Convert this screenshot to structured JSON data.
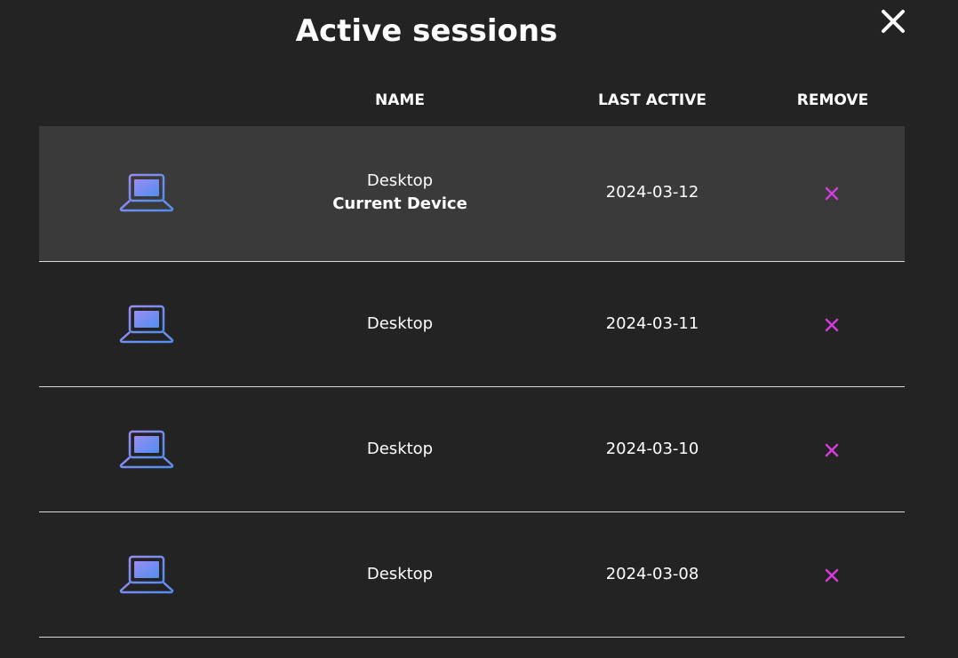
{
  "dialog": {
    "title": "Active sessions",
    "close_icon": "close-icon"
  },
  "table": {
    "headers": {
      "name": "NAME",
      "last_active": "LAST ACTIVE",
      "remove": "REMOVE"
    },
    "rows": [
      {
        "icon": "laptop-icon",
        "name": "Desktop",
        "sub_label": "Current Device",
        "last_active": "2024-03-12",
        "remove_icon": "remove-x-icon",
        "highlighted": true
      },
      {
        "icon": "laptop-icon",
        "name": "Desktop",
        "sub_label": "",
        "last_active": "2024-03-11",
        "remove_icon": "remove-x-icon",
        "highlighted": false
      },
      {
        "icon": "laptop-icon",
        "name": "Desktop",
        "sub_label": "",
        "last_active": "2024-03-10",
        "remove_icon": "remove-x-icon",
        "highlighted": false
      },
      {
        "icon": "laptop-icon",
        "name": "Desktop",
        "sub_label": "",
        "last_active": "2024-03-08",
        "remove_icon": "remove-x-icon",
        "highlighted": false
      }
    ]
  },
  "colors": {
    "background": "#232323",
    "highlight_row": "#3a3a3a",
    "divider": "#d9d9d9",
    "remove_accent": "#d63bdc",
    "icon_gradient_start": "#9b8cf2",
    "icon_gradient_end": "#4f8ef0"
  }
}
